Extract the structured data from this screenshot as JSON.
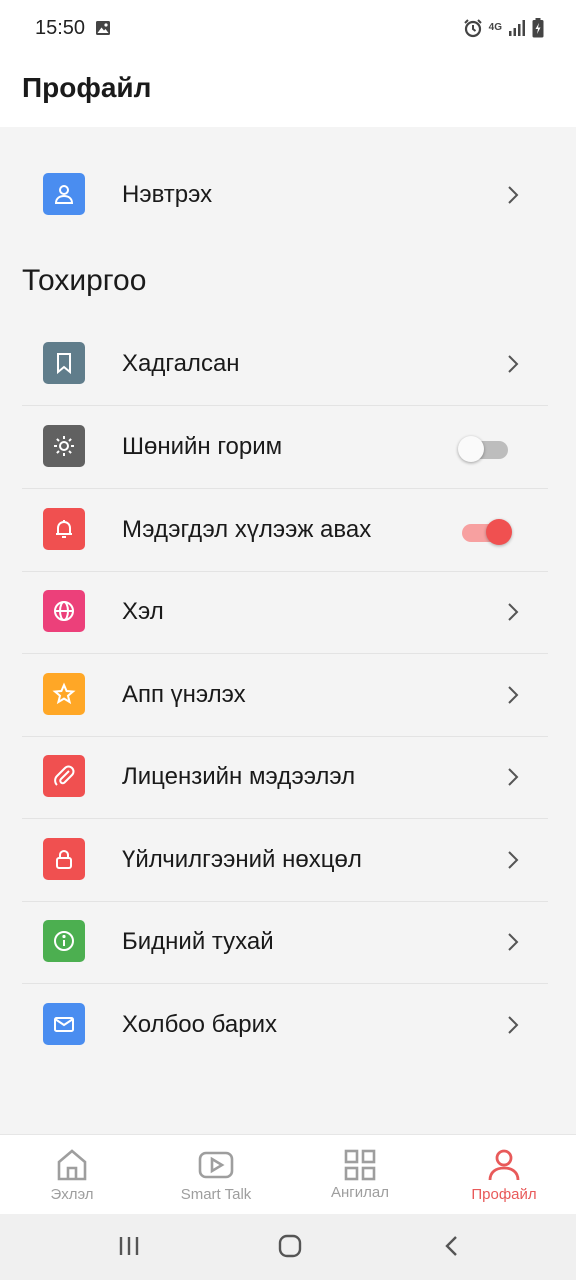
{
  "status_bar": {
    "time": "15:50",
    "network_label": "4G"
  },
  "header": {
    "title": "Профайл"
  },
  "login_row": {
    "label": "Нэвтрэх",
    "icon": "user-icon",
    "color": "#4a8df0"
  },
  "settings": {
    "section_title": "Тохиргоо",
    "items": [
      {
        "label": "Хадгалсан",
        "icon": "bookmark-icon",
        "color": "#607d8b",
        "control": "chevron"
      },
      {
        "label": "Шөнийн горим",
        "icon": "sun-icon",
        "color": "#616161",
        "control": "toggle",
        "enabled": false
      },
      {
        "label": "Мэдэгдэл хүлээж авах",
        "icon": "bell-icon",
        "color": "#f05050",
        "control": "toggle",
        "enabled": true
      },
      {
        "label": "Хэл",
        "icon": "globe-icon",
        "color": "#ec407a",
        "control": "chevron"
      },
      {
        "label": "Апп үнэлэх",
        "icon": "star-icon",
        "color": "#ffa726",
        "control": "chevron"
      },
      {
        "label": "Лицензийн мэдээлэл",
        "icon": "paperclip-icon",
        "color": "#f05050",
        "control": "chevron"
      },
      {
        "label": "Үйлчилгээний нөхцөл",
        "icon": "lock-icon",
        "color": "#f05050",
        "control": "chevron"
      },
      {
        "label": "Бидний тухай",
        "icon": "info-icon",
        "color": "#4caf50",
        "control": "chevron"
      },
      {
        "label": "Холбоо барих",
        "icon": "mail-icon",
        "color": "#4a8df0",
        "control": "chevron"
      }
    ]
  },
  "bottom_nav": {
    "items": [
      {
        "label": "Эхлэл",
        "icon": "home-icon",
        "active": false
      },
      {
        "label": "Smart Talk",
        "icon": "play-icon",
        "active": false
      },
      {
        "label": "Ангилал",
        "icon": "grid-icon",
        "active": false
      },
      {
        "label": "Профайл",
        "icon": "user-icon",
        "active": true
      }
    ],
    "active_color": "#e85a5a",
    "inactive_color": "#9e9e9e"
  }
}
